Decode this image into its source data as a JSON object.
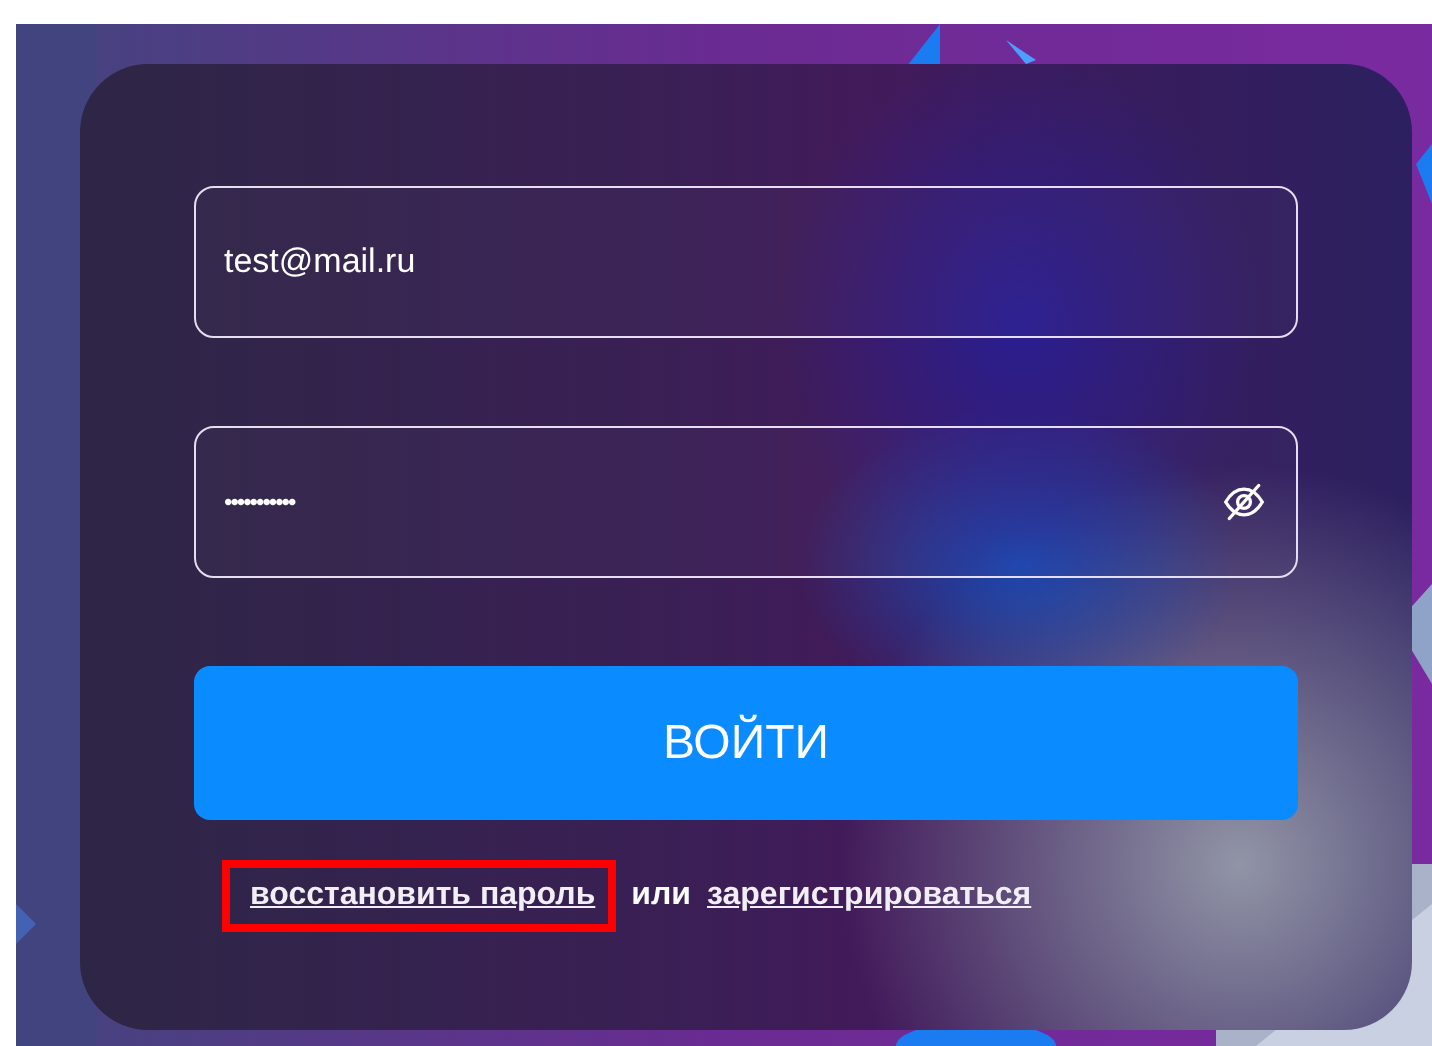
{
  "login_form": {
    "email": {
      "value": "test@mail.ru"
    },
    "password": {
      "value": "•••••••••••",
      "hidden": true
    },
    "submit_button": {
      "label": "ВОЙТИ"
    },
    "links": [
      {
        "kind": "link",
        "text": "восстановить пароль",
        "highlighted": true
      },
      {
        "kind": "text",
        "text": "или",
        "highlighted": false
      },
      {
        "kind": "link",
        "text": "зарегистрироваться",
        "highlighted": false
      }
    ]
  }
}
